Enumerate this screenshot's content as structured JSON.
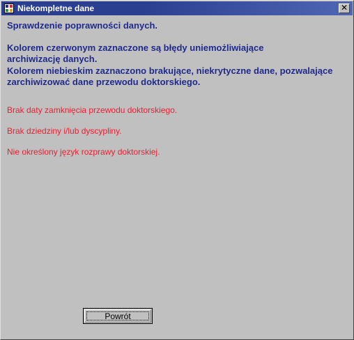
{
  "window": {
    "title": "Niekompletne dane",
    "close_label": "✕"
  },
  "content": {
    "heading": "Sprawdzenie poprawności danych.",
    "red_info_line1": "Kolorem czerwonym zaznaczone są błędy uniemożliwiające",
    "red_info_line2": "archiwizację danych.",
    "blue_info_line1": "Kolorem niebieskim zaznaczono brakujące, niekrytyczne dane, pozwalające",
    "blue_info_line2": "zarchiwizować dane przewodu doktorskiego."
  },
  "errors": [
    "Brak daty zamknięcia przewodu doktorskiego.",
    "Brak dziedziny i/lub dyscypliny.",
    "Nie określony język rozprawy doktorskiej."
  ],
  "buttons": {
    "back_label": "Powrót"
  },
  "colors": {
    "title_bar": "#2a3f8f",
    "info_text": "#1f2a8c",
    "error_text": "#ee1c2e",
    "background": "#c0c0c0"
  },
  "icons": {
    "app": "app-logo-icon",
    "close": "close-icon"
  }
}
